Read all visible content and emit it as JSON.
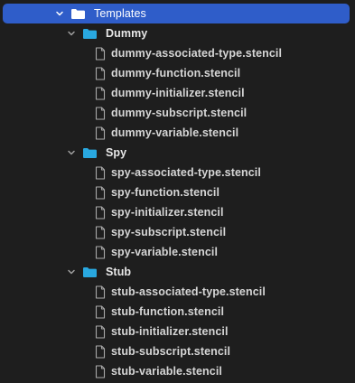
{
  "root": {
    "label": "Templates",
    "expanded": true,
    "selected": true,
    "icon": "folder-icon"
  },
  "groups": [
    {
      "label": "Dummy",
      "expanded": true,
      "icon": "folder-icon",
      "files": [
        "dummy-associated-type.stencil",
        "dummy-function.stencil",
        "dummy-initializer.stencil",
        "dummy-subscript.stencil",
        "dummy-variable.stencil"
      ]
    },
    {
      "label": "Spy",
      "expanded": true,
      "icon": "folder-icon",
      "files": [
        "spy-associated-type.stencil",
        "spy-function.stencil",
        "spy-initializer.stencil",
        "spy-subscript.stencil",
        "spy-variable.stencil"
      ]
    },
    {
      "label": "Stub",
      "expanded": true,
      "icon": "folder-icon",
      "files": [
        "stub-associated-type.stencil",
        "stub-function.stencil",
        "stub-initializer.stencil",
        "stub-subscript.stencil",
        "stub-variable.stencil"
      ]
    }
  ],
  "colors": {
    "background": "#1e1e1e",
    "selection": "#2f5dc9",
    "folder": "#29a8e0",
    "file_icon": "#a9a9a9",
    "disclosure": "#a0a0a0"
  }
}
